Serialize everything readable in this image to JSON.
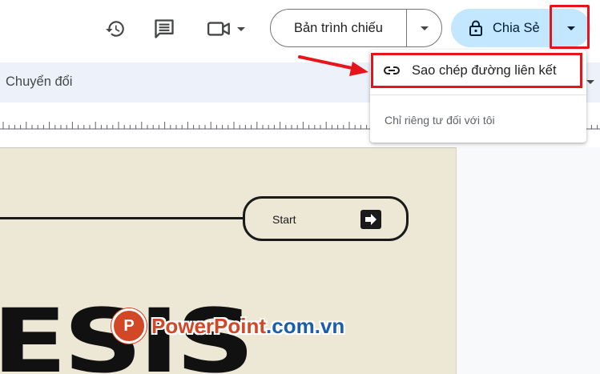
{
  "topbar": {
    "history_icon": "history-icon",
    "comment_icon": "comment-icon",
    "meet_icon": "video-camera-icon",
    "present_label": "Bản trình chiếu",
    "share_label": "Chia Sẻ",
    "share_icon": "lock-icon"
  },
  "toolbar": {
    "label": "Chuyển đổi"
  },
  "share_menu": {
    "items": [
      {
        "label": "Sao chép đường liên kết",
        "icon": "link-icon"
      }
    ],
    "caption": "Chỉ riêng tư đối với tôi"
  },
  "slide": {
    "button_label": "Start",
    "title_fragment": "ESIS"
  },
  "watermark": {
    "brand": "PowerPoint",
    "domain": ".com.vn",
    "logo_letter": "P"
  },
  "colors": {
    "share_bg": "#c2e7ff",
    "toolbar_bg": "#edf2fa",
    "highlight": "#e8141c",
    "slide_bg": "#ede7d6"
  }
}
